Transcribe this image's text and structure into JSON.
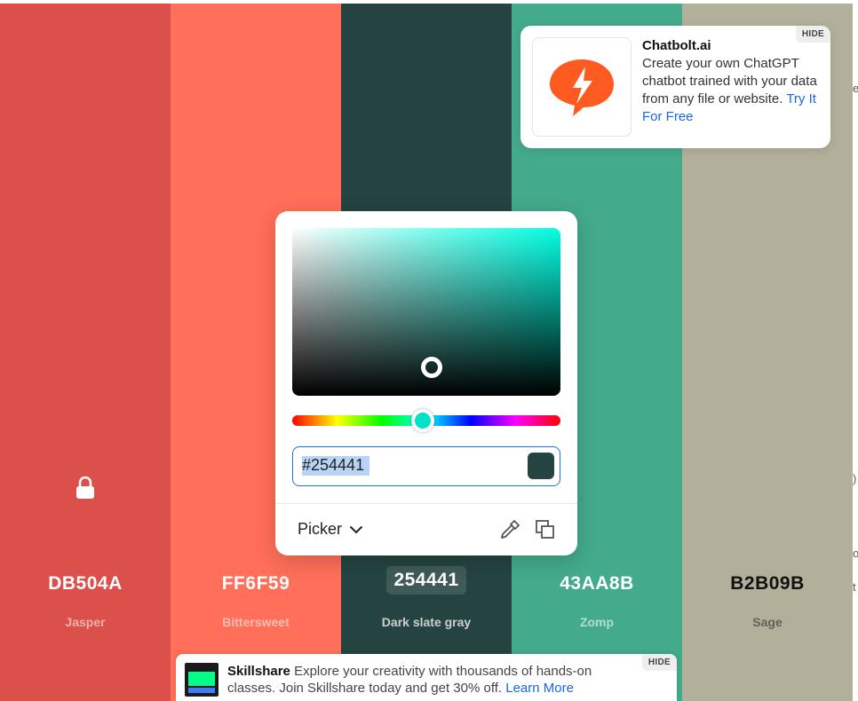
{
  "palette": {
    "swatches": [
      {
        "hex": "DB504A",
        "name": "Jasper",
        "color": "#DB504A",
        "text_color": "#ffffff",
        "name_color": "rgba(255,255,255,0.55)"
      },
      {
        "hex": "FF6F59",
        "name": "Bittersweet",
        "color": "#FF6F59",
        "text_color": "#ffffff",
        "name_color": "rgba(255,255,255,0.55)"
      },
      {
        "hex": "254441",
        "name": "Dark slate gray",
        "color": "#254441",
        "text_color": "#ffffff",
        "name_color": "rgba(255,255,255,0.75)"
      },
      {
        "hex": "43AA8B",
        "name": "Zomp",
        "color": "#43AA8B",
        "text_color": "#ffffff",
        "name_color": "rgba(255,255,255,0.6)"
      },
      {
        "hex": "B2B09B",
        "name": "Sage",
        "color": "#B2B09B",
        "text_color": "#111111",
        "name_color": "rgba(0,0,0,0.45)"
      }
    ],
    "locked_icon": "lock-icon"
  },
  "ad_top": {
    "title": "Chatbolt.ai",
    "body": "Create your own ChatGPT chatbot trained with your data from any file or website.",
    "link": "Try It For Free",
    "hide_label": "HIDE",
    "logo_icon": "chatbolt-logo-icon",
    "logo_color": "#ff5a1f"
  },
  "picker": {
    "hex_value": "#254441",
    "mode_label": "Picker",
    "current_color": "#254441",
    "hue_color": "#00ffe2",
    "eyedropper_icon": "eyedropper-icon",
    "copy_icon": "copy-icon"
  },
  "ad_bottom": {
    "brand": "Skillshare",
    "body": "Explore your creativity with thousands of hands-on classes. Join Skillshare today and get 30% off.",
    "link": "Learn More",
    "hide_label": "HIDE"
  }
}
